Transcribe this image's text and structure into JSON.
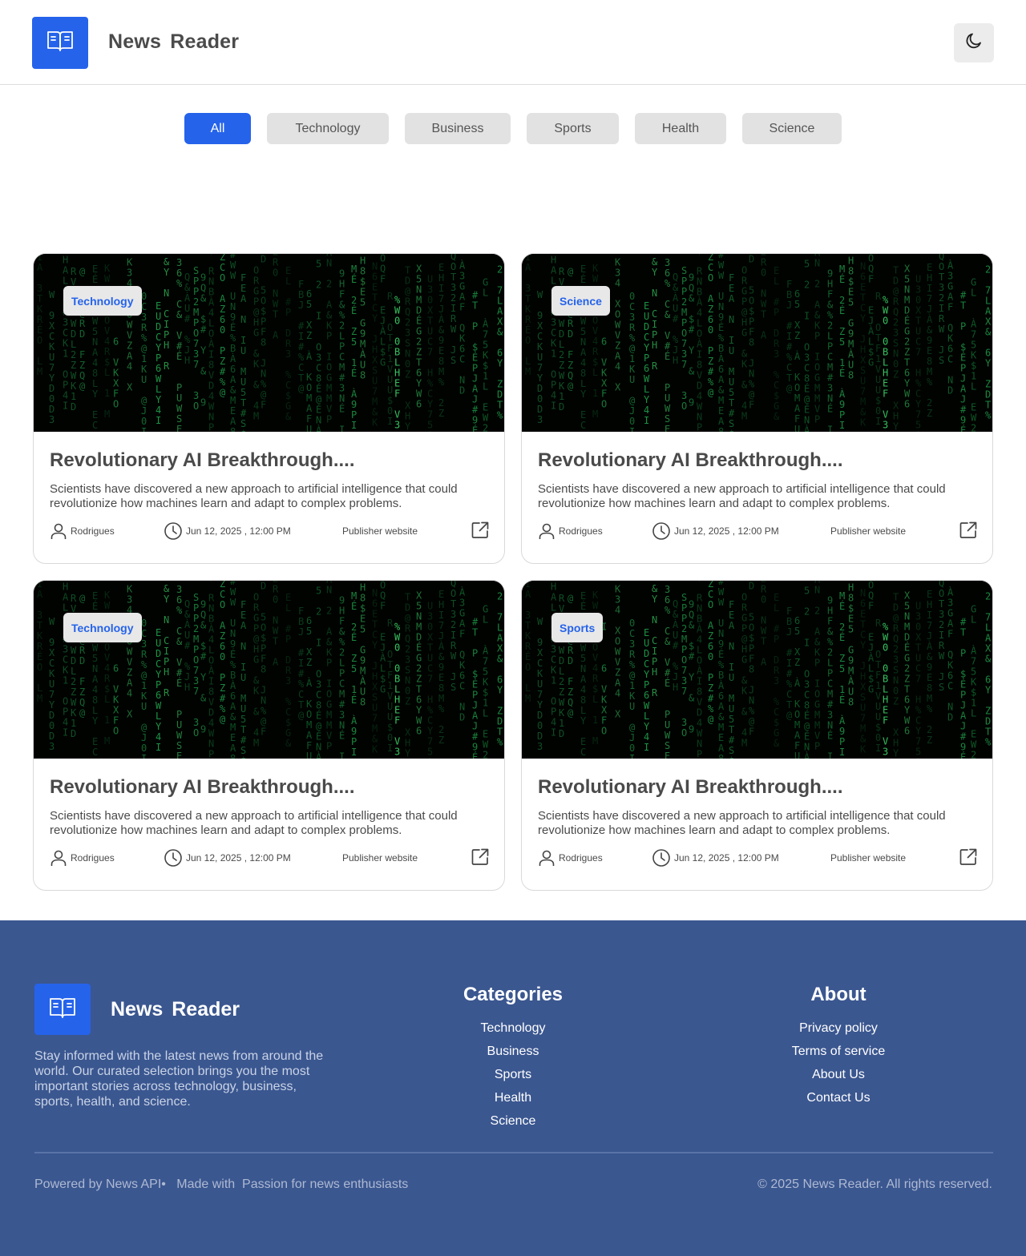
{
  "app": {
    "title": "News  Reader"
  },
  "colors": {
    "accent": "#2563eb",
    "footer_bg": "#3b5790"
  },
  "tabs": [
    {
      "label": "All",
      "active": true
    },
    {
      "label": "Technology"
    },
    {
      "label": "Business"
    },
    {
      "label": "Sports"
    },
    {
      "label": "Health"
    },
    {
      "label": "Science"
    }
  ],
  "articles": [
    {
      "category": "Technology",
      "title": "Revolutionary AI Breakthrough....",
      "description": "Scientists have discovered a new approach to artificial intelligence that could revolutionize how machines learn and adapt to complex problems.",
      "author": "Rodrigues",
      "date": "Jun  12, 2025 , 12:00 PM",
      "publisher": "Publisher website"
    },
    {
      "category": "Science",
      "title": "Revolutionary AI Breakthrough....",
      "description": "Scientists have discovered a new approach to artificial intelligence that could revolutionize how machines learn and adapt to complex problems.",
      "author": "Rodrigues",
      "date": "Jun  12, 2025 , 12:00 PM",
      "publisher": "Publisher website"
    },
    {
      "category": "Technology",
      "title": "Revolutionary AI Breakthrough....",
      "description": "Scientists have discovered a new approach to artificial intelligence that could revolutionize how machines learn and adapt to complex problems.",
      "author": "Rodrigues",
      "date": "Jun  12, 2025 , 12:00 PM",
      "publisher": "Publisher website"
    },
    {
      "category": "Sports",
      "title": "Revolutionary AI Breakthrough....",
      "description": "Scientists have discovered a new approach to artificial intelligence that could revolutionize how machines learn and adapt to complex problems.",
      "author": "Rodrigues",
      "date": "Jun  12, 2025 , 12:00 PM",
      "publisher": "Publisher website"
    }
  ],
  "footer": {
    "title": "News  Reader",
    "description": "Stay informed with the latest news from around the world. Our curated selection brings you the most important stories across technology, business, sports, health, and science.",
    "categories_heading": "Categories",
    "categories": [
      "Technology",
      "Business",
      "Sports",
      "Health",
      "Science"
    ],
    "about_heading": "About",
    "about_links": [
      "Privacy policy",
      "Terms of service",
      "About Us",
      "Contact Us"
    ],
    "bottom_left": "Powered by News API•   Made with  Passion for news enthusiasts",
    "bottom_right": "© 2025 News Reader. All rights reserved."
  },
  "icons": {
    "logo": "book-open-icon",
    "theme": "moon-icon",
    "author": "user-icon",
    "date": "clock-icon",
    "external": "external-link-icon"
  }
}
